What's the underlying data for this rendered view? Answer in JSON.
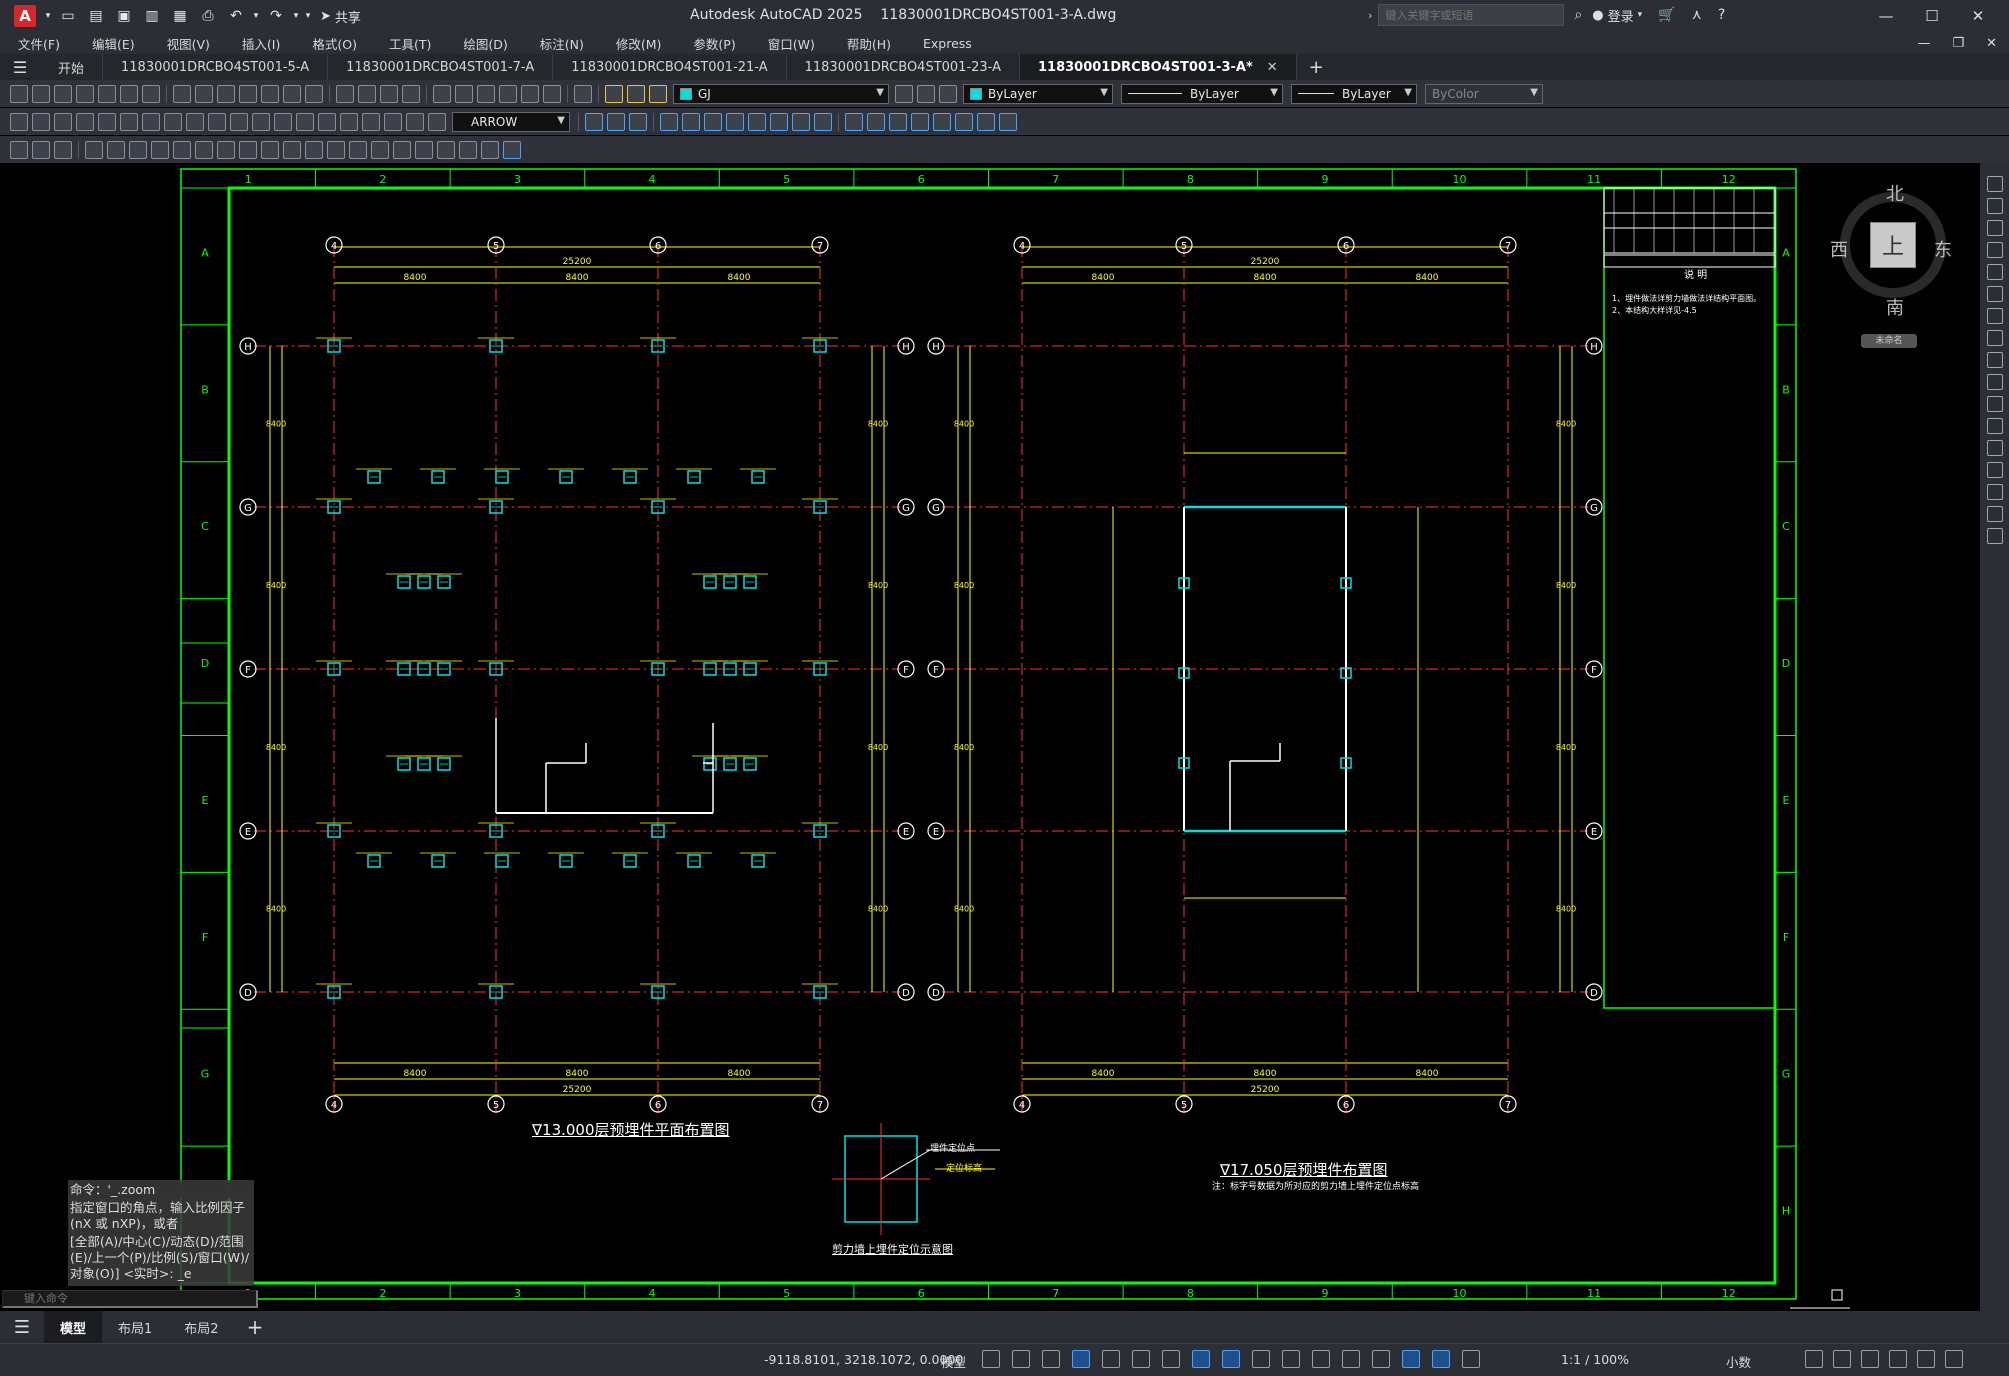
{
  "app": {
    "title": "Autodesk AutoCAD 2025",
    "file": "11830001DRCBO4ST001-3-A.dwg",
    "share": "共享",
    "logo": "A"
  },
  "search": {
    "placeholder": "键入关键字或短语"
  },
  "user": {
    "login": "登录"
  },
  "menu": [
    "文件(F)",
    "编辑(E)",
    "视图(V)",
    "插入(I)",
    "格式(O)",
    "工具(T)",
    "绘图(D)",
    "标注(N)",
    "修改(M)",
    "参数(P)",
    "窗口(W)",
    "帮助(H)",
    "Express"
  ],
  "tabs": [
    {
      "label": "开始"
    },
    {
      "label": "11830001DRCBO4ST001-5-A"
    },
    {
      "label": "11830001DRCBO4ST001-7-A"
    },
    {
      "label": "11830001DRCBO4ST001-21-A"
    },
    {
      "label": "11830001DRCBO4ST001-23-A"
    },
    {
      "label": "11830001DRCBO4ST001-3-A*",
      "active": true
    }
  ],
  "toolbar": {
    "layer": "GJ",
    "color": "ByLayer",
    "linetype": "ByLayer",
    "lineweight": "ByLayer",
    "plotstyle": "ByColor",
    "dimstyle": "ARROW"
  },
  "drawing": {
    "left_plan_title": "∇13.000层预埋件平面布置图",
    "right_plan_title": "∇17.050层预埋件布置图",
    "right_plan_note": "注：标字号数据为所对应的剪力墙上埋件定位点标高",
    "detail_title": "剪力墙上埋件定位示意图",
    "detail_label1": "埋件定位点",
    "detail_label2": "定位标高",
    "notes_header": "说 明",
    "notes": [
      "1、埋件做法详剪力墙做法详结构平面图。",
      "2、本结构大样详见-4.5"
    ],
    "axis_top": [
      "1",
      "2",
      "3",
      "4",
      "5",
      "6",
      "7",
      "8",
      "9",
      "10",
      "11",
      "12"
    ],
    "axis_side": [
      "A",
      "B",
      "C",
      "D",
      "E",
      "F",
      "G",
      "H"
    ],
    "grid_cols": [
      "4",
      "5",
      "6",
      "7"
    ],
    "grid_rows": [
      "H",
      "G",
      "F",
      "E",
      "D"
    ],
    "dim_total": "25200",
    "dim_bay": "8400"
  },
  "viewcube": {
    "north": "北",
    "south": "南",
    "east": "东",
    "west": "西",
    "top": "上",
    "ucs": "未命名"
  },
  "command": {
    "history": [
      "命令：'_.zoom",
      "指定窗口的角点，输入比例因子 (nX 或 nXP)，或者",
      "[全部(A)/中心(C)/动态(D)/范围(E)/上一个(P)/比例(S)/窗口(W)/对象(O)] <实时>: _e"
    ],
    "input_placeholder": "键入命令"
  },
  "layouts": [
    {
      "label": "模型",
      "active": true
    },
    {
      "label": "布局1"
    },
    {
      "label": "布局2"
    }
  ],
  "status": {
    "coords": "-9118.8101, 3218.1072, 0.0000",
    "space": "模型",
    "scale": "1:1 / 100%",
    "units": "小数"
  }
}
